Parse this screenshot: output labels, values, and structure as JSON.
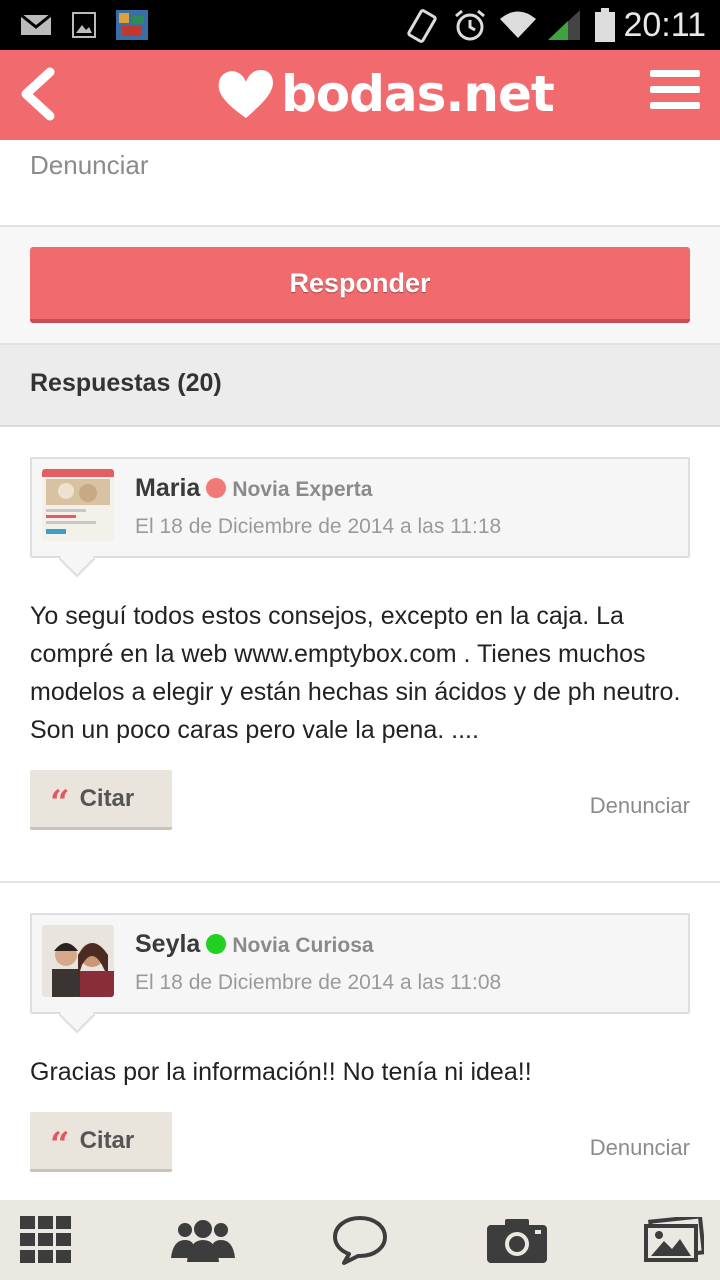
{
  "status_bar": {
    "time": "20:11"
  },
  "header": {
    "logo_text": "bodas.net"
  },
  "top_report_label": "Denunciar",
  "reply_button_label": "Responder",
  "answers_title": "Respuestas (20)",
  "posts": [
    {
      "author": "Maria",
      "status_color": "#f07a78",
      "rank": "Novia Experta",
      "date": "El 18 de Diciembre de 2014 a las 11:18",
      "body": "Yo seguí todos estos consejos, excepto en la caja. La compré en la web www.emptybox.com . Tienes muchos modelos a elegir y están hechas sin ácidos y de ph neutro. Son un poco caras pero vale la pena. ....",
      "cite_label": "Citar",
      "report_label": "Denunciar"
    },
    {
      "author": "Seyla",
      "status_color": "#22d022",
      "rank": "Novia Curiosa",
      "date": "El 18 de Diciembre de 2014 a las 11:08",
      "body": "Gracias por la información!! No tenía ni idea!!",
      "cite_label": "Citar",
      "report_label": "Denunciar"
    }
  ],
  "bottom_nav": [
    "grid-icon",
    "community-icon",
    "chat-icon",
    "camera-icon",
    "photos-icon"
  ]
}
